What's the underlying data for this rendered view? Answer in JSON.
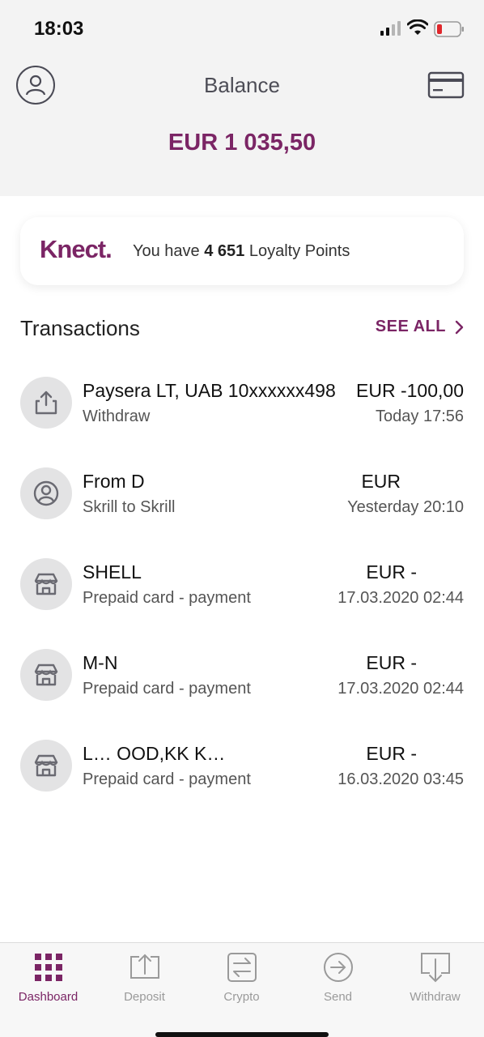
{
  "status": {
    "time": "18:03"
  },
  "header": {
    "title": "Balance"
  },
  "balance": {
    "amount": "EUR 1 035,50"
  },
  "loyalty": {
    "brand": "Knect.",
    "text_prefix": "You have ",
    "points": "4 651",
    "text_suffix": " Loyalty Points"
  },
  "transactions": {
    "title": "Transactions",
    "see_all": "SEE ALL",
    "items": [
      {
        "name": "Paysera LT, UAB 10xxxxxx498",
        "type": "Withdraw",
        "amount": "EUR -100,00",
        "date": "Today 17:56",
        "icon": "upload-icon"
      },
      {
        "name": "From D",
        "type": "Skrill to Skrill",
        "amount": "EUR",
        "date": "Yesterday 20:10",
        "icon": "person-icon"
      },
      {
        "name": "SHELL",
        "type": "Prepaid card - payment",
        "amount": "EUR -",
        "date": "17.03.2020 02:44",
        "icon": "shop-icon"
      },
      {
        "name": "M-N",
        "type": "Prepaid card - payment",
        "amount": "EUR -",
        "date": "17.03.2020 02:44",
        "icon": "shop-icon"
      },
      {
        "name": "L… OOD,KK K…",
        "type": "Prepaid card - payment",
        "amount": "EUR -",
        "date": "16.03.2020 03:45",
        "icon": "shop-icon"
      }
    ]
  },
  "tabbar": {
    "items": [
      {
        "label": "Dashboard",
        "icon": "grid-icon",
        "active": true
      },
      {
        "label": "Deposit",
        "icon": "deposit-icon",
        "active": false
      },
      {
        "label": "Crypto",
        "icon": "exchange-icon",
        "active": false
      },
      {
        "label": "Send",
        "icon": "send-icon",
        "active": false
      },
      {
        "label": "Withdraw",
        "icon": "withdraw-icon",
        "active": false
      }
    ]
  },
  "colors": {
    "accent": "#7b2565",
    "icon_bg": "#e3e3e4",
    "tab_inactive": "#9a9a9a"
  }
}
